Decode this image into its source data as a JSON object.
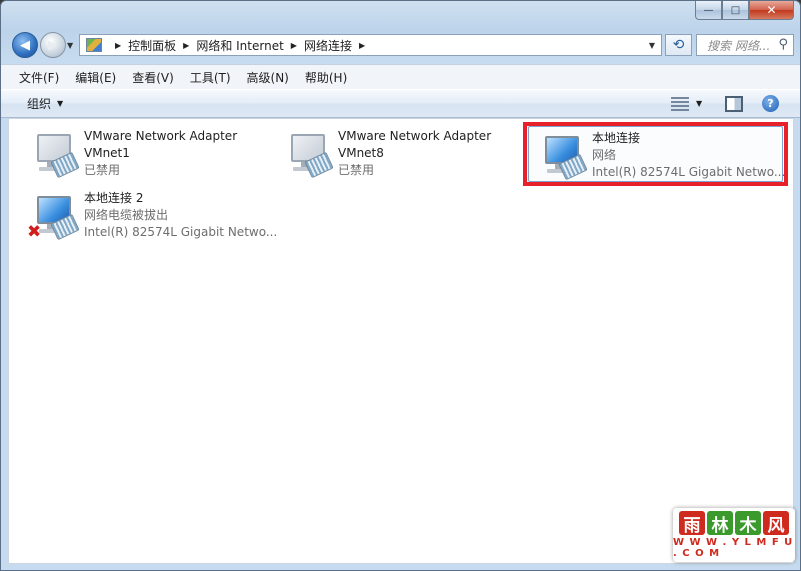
{
  "window": {
    "caption_buttons": {
      "minimize": "—",
      "maximize": "□",
      "close": "✕"
    }
  },
  "nav": {
    "back": "◀",
    "forward": "▶",
    "breadcrumbs": [
      "控制面板",
      "网络和 Internet",
      "网络连接"
    ],
    "refresh": "⟲",
    "search_placeholder": "搜索 网络...",
    "search_icon": "search-icon"
  },
  "menubar": {
    "items": [
      "文件(F)",
      "编辑(E)",
      "查看(V)",
      "工具(T)",
      "高级(N)",
      "帮助(H)"
    ]
  },
  "cmdbar": {
    "organize": "组织",
    "help": "?"
  },
  "connections": [
    {
      "name": "VMware Network Adapter",
      "line2": "VMnet1",
      "line3": "已禁用",
      "status_icon": "network-disabled-icon"
    },
    {
      "name": "VMware Network Adapter",
      "line2": "VMnet8",
      "line3": "已禁用",
      "status_icon": "network-disabled-icon"
    },
    {
      "name": "本地连接",
      "line2": "网络",
      "line3": "Intel(R) 82574L Gigabit Netwo...",
      "status_icon": "network-connected-icon",
      "selected": true
    },
    {
      "name": "本地连接 2",
      "line2": "网络电缆被拔出",
      "line3": "Intel(R) 82574L Gigabit Netwo...",
      "status_icon": "network-unplugged-icon"
    }
  ],
  "watermark": {
    "chars": [
      "雨",
      "林",
      "木",
      "风"
    ],
    "url": "W W W . Y L M F U . C O M"
  },
  "colors": {
    "highlight_border": "#e8202a",
    "selection_border": "#7da2ce"
  }
}
